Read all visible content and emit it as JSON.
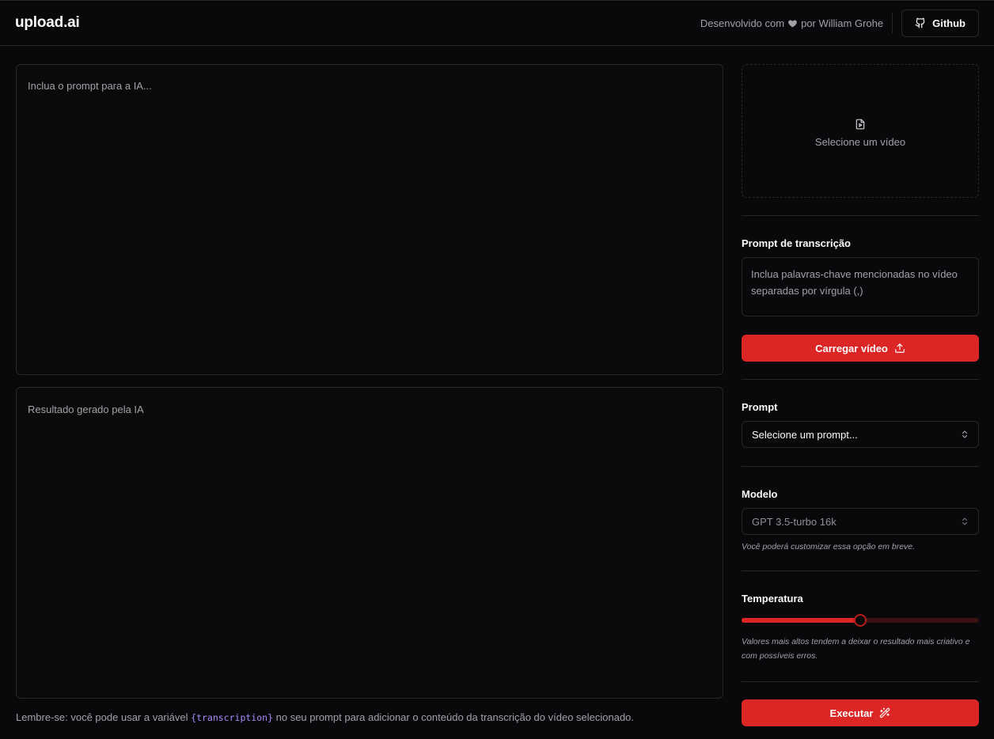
{
  "header": {
    "logo": "upload.ai",
    "credit_prefix": "Desenvolvido com",
    "credit_suffix": "por William Grohe",
    "github_label": "Github"
  },
  "main": {
    "prompt_placeholder": "Inclua o prompt para a IA...",
    "result_placeholder": "Resultado gerado pela IA",
    "hint_before": "Lembre-se: você pode usar a variável",
    "hint_variable": "{transcription}",
    "hint_after": "no seu prompt para adicionar o conteúdo da transcrição do vídeo selecionado."
  },
  "sidebar": {
    "video_drop_label": "Selecione um vídeo",
    "transcription_label": "Prompt de transcrição",
    "transcription_placeholder": "Inclua palavras-chave mencionadas no vídeo separadas por vírgula (,)",
    "upload_button": "Carregar vídeo",
    "prompt_label": "Prompt",
    "prompt_select_value": "Selecione um prompt...",
    "model_label": "Modelo",
    "model_select_value": "GPT 3.5-turbo 16k",
    "model_note": "Você poderá customizar essa opção em breve.",
    "temperature_label": "Temperatura",
    "temperature_value": 0.5,
    "temperature_note": "Valores mais altos tendem a deixar o resultado mais criativo e com possíveis erros.",
    "execute_button": "Executar"
  },
  "colors": {
    "background": "#09090b",
    "border": "#27272a",
    "accent": "#dc2626",
    "muted_text": "#a1a1aa",
    "variable_code": "#a78bfa"
  },
  "icons": {
    "heart": "heart-icon",
    "github": "github-icon",
    "video": "file-video-icon",
    "upload": "upload-icon",
    "select": "chevrons-up-down-icon",
    "execute": "wand-icon"
  }
}
